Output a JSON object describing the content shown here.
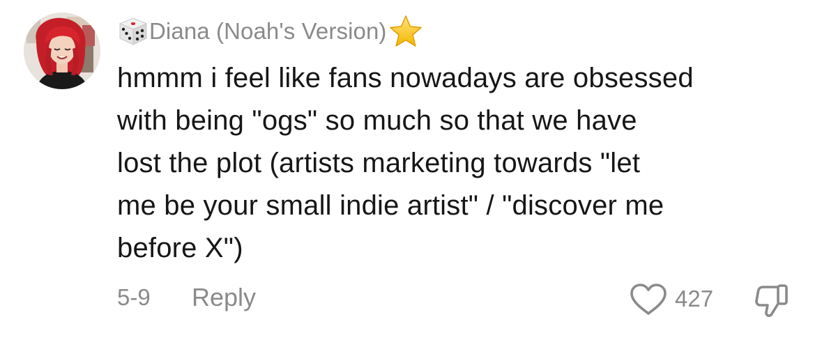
{
  "comment": {
    "username": "Diana (Noah's Version)",
    "username_prefix_icon": "game-die-icon",
    "username_suffix_icon": "star-icon",
    "text_lines": [
      "hmmm i feel like fans nowadays are obsessed",
      "with being \"ogs\" so much so that we have",
      "lost the plot (artists marketing towards \"let",
      "me be your small indie artist\" / \"discover me",
      "before X\")"
    ],
    "date": "5-9",
    "reply_label": "Reply",
    "like_count": "427",
    "like_icon": "heart-outline-icon",
    "dislike_icon": "thumbs-down-icon"
  },
  "colors": {
    "text": "#161616",
    "muted": "#8a8a8a",
    "star": "#f5c518",
    "avatar_hair": "#c8202a"
  }
}
